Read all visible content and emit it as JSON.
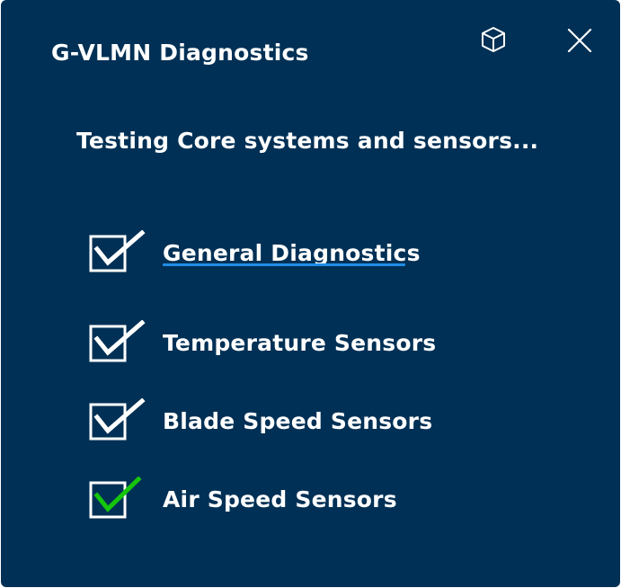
{
  "window": {
    "title": "G-VLMN Diagnostics",
    "background": "#003055",
    "icons": {
      "cube": "cube-icon",
      "close": "close-icon"
    }
  },
  "status_text": "Testing Core systems and sensors...",
  "checks": [
    {
      "label": "General Diagnostics",
      "checked": true,
      "focused": true,
      "check_color": "#ffffff"
    },
    {
      "label": "Temperature Sensors",
      "checked": true,
      "focused": false,
      "check_color": "#ffffff"
    },
    {
      "label": "Blade Speed Sensors",
      "checked": true,
      "focused": false,
      "check_color": "#ffffff"
    },
    {
      "label": "Air Speed Sensors",
      "checked": true,
      "focused": false,
      "check_color": "#16c60c"
    }
  ],
  "colors": {
    "focus_underline": "#1e8ee8",
    "success_check": "#16c60c",
    "text": "#ffffff"
  }
}
